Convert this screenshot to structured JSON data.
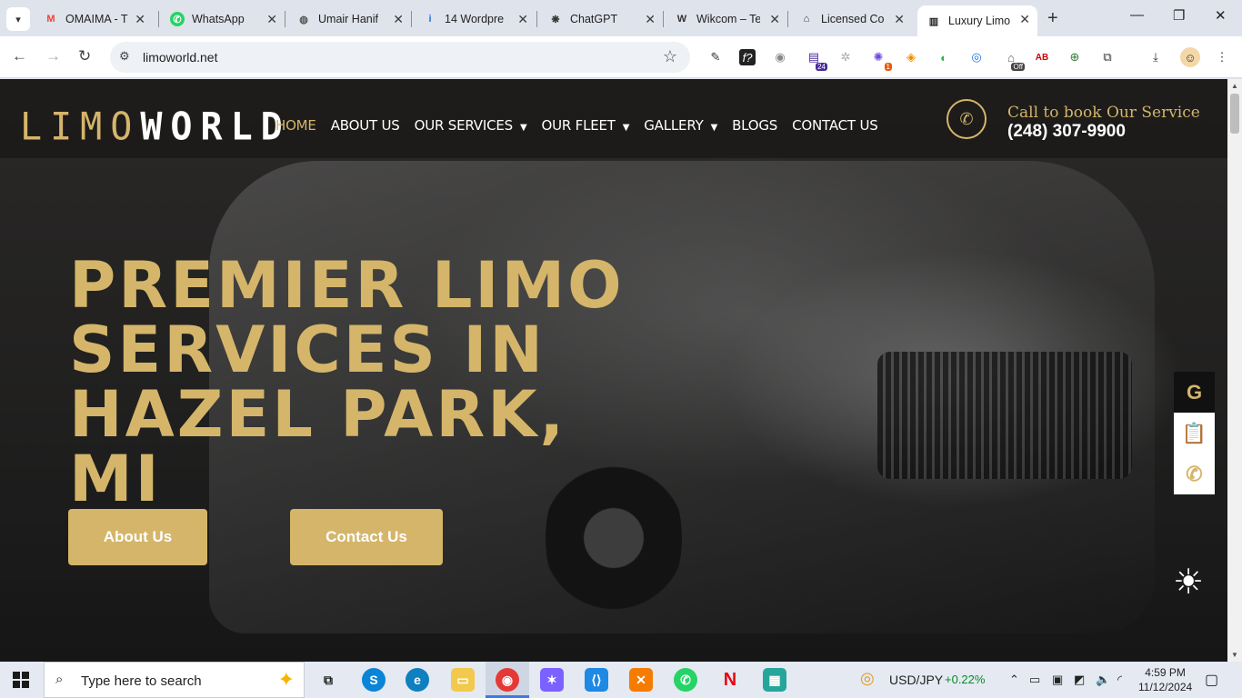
{
  "browser": {
    "tabs": [
      {
        "title": "OMAIMA - T",
        "favicon": "gmail-icon",
        "fav_glyph": "M",
        "fav_color": "#ea4335"
      },
      {
        "title": "WhatsApp",
        "favicon": "whatsapp-icon",
        "fav_glyph": "✆",
        "fav_color": "#25d366"
      },
      {
        "title": "Umair Hanif",
        "favicon": "globe-icon",
        "fav_glyph": "◍",
        "fav_color": "#555555"
      },
      {
        "title": "14 Wordpre",
        "favicon": "info-icon",
        "fav_glyph": "i",
        "fav_color": "#1a73e8"
      },
      {
        "title": "ChatGPT",
        "favicon": "chatgpt-icon",
        "fav_glyph": "❋",
        "fav_color": "#333333"
      },
      {
        "title": "Wikcom – Te",
        "favicon": "wordpress-icon",
        "fav_glyph": "W",
        "fav_color": "#333333"
      },
      {
        "title": "Licensed Co",
        "favicon": "home-icon",
        "fav_glyph": "⌂",
        "fav_color": "#333333"
      },
      {
        "title": "Luxury Limo",
        "favicon": "limoworld-icon",
        "fav_glyph": "▥",
        "fav_color": "#222222"
      }
    ],
    "url": "limoworld.net",
    "extension_badges": {
      "calendar": "24",
      "puzzle_badge": "1",
      "off_badge": "Off"
    }
  },
  "site": {
    "logo": {
      "part1": "LIMO",
      "part2": "WORLD"
    },
    "nav": [
      {
        "label": "HOME",
        "active": true,
        "dropdown": false
      },
      {
        "label": "ABOUT US",
        "active": false,
        "dropdown": false
      },
      {
        "label": "OUR SERVICES",
        "active": false,
        "dropdown": true
      },
      {
        "label": "OUR FLEET",
        "active": false,
        "dropdown": true
      },
      {
        "label": "GALLERY",
        "active": false,
        "dropdown": true
      },
      {
        "label": "BLOGS",
        "active": false,
        "dropdown": false
      },
      {
        "label": "CONTACT US",
        "active": false,
        "dropdown": false
      }
    ],
    "call": {
      "label": "Call to book Our Service",
      "phone": "(248) 307-9900"
    },
    "hero": {
      "title": "PREMIER LIMO SERVICES IN HAZEL PARK, MI",
      "button_about": "About Us",
      "button_contact": "Contact Us"
    },
    "side_icons": [
      "google-icon",
      "clipboard-icon",
      "phone-icon"
    ],
    "side_glyphs": {
      "google": "G",
      "clipboard": "📋",
      "phone": "✆"
    },
    "theme_toggle": "sun-icon",
    "accent_color": "#d4b56a"
  },
  "taskbar": {
    "search_placeholder": "Type here to search",
    "ticker": {
      "pair": "USD/JPY",
      "change": "+0.22%"
    },
    "clock": {
      "time": "4:59 PM",
      "date": "11/12/2024"
    }
  }
}
